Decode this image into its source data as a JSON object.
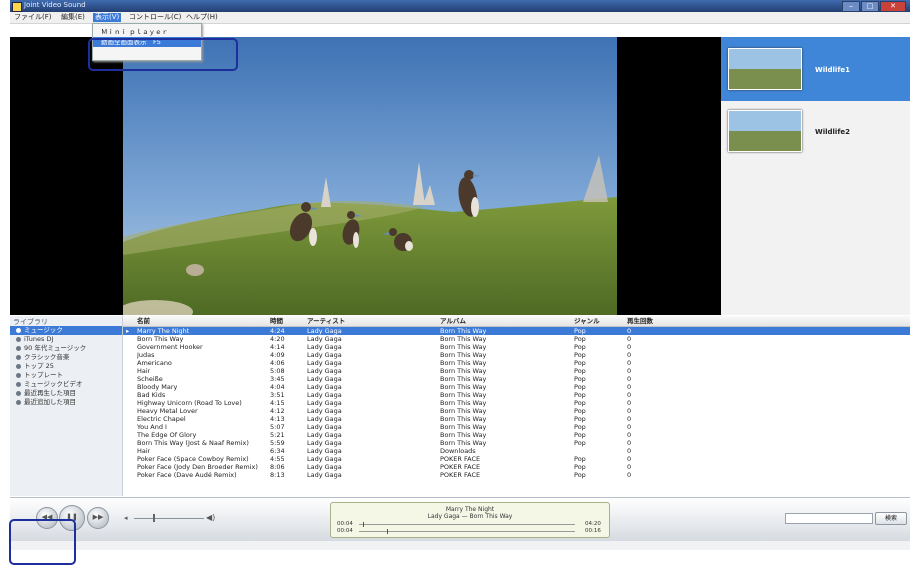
{
  "window": {
    "title": "Joint Video Sound"
  },
  "menu": [
    {
      "label": "ファイル(F)",
      "x": 0
    },
    {
      "label": "編集(E)"
    },
    {
      "label": "表示(V)"
    },
    {
      "label": "コントロール(C)"
    },
    {
      "label": "ヘルプ(H)"
    }
  ],
  "view_menu": {
    "items": [
      {
        "label": "Ｍｉｎｉ ｐｌａｙｅｒ"
      },
      {
        "label": "動画全画面表示　F5"
      }
    ]
  },
  "videos": [
    {
      "label": "Wildlife1",
      "selected": true
    },
    {
      "label": "Wildlife2",
      "selected": false
    }
  ],
  "library": {
    "header": "ライブラリ",
    "items": [
      "ミュージック",
      "iTunes DJ",
      "90 年代ミュージック",
      "クラシック音楽",
      "トップ 25",
      "トップレート",
      "ミュージックビデオ",
      "最近再生した項目",
      "最近追加した項目"
    ]
  },
  "table": {
    "columns": [
      "名前",
      "時間",
      "アーティスト",
      "アルバム",
      "ジャンル",
      "再生回数"
    ],
    "rows": [
      [
        "Marry The Night",
        "4:24",
        "Lady Gaga",
        "Born This Way",
        "Pop",
        "0"
      ],
      [
        "Born This Way",
        "4:20",
        "Lady Gaga",
        "Born This Way",
        "Pop",
        "0"
      ],
      [
        "Government Hooker",
        "4:14",
        "Lady Gaga",
        "Born This Way",
        "Pop",
        "0"
      ],
      [
        "Judas",
        "4:09",
        "Lady Gaga",
        "Born This Way",
        "Pop",
        "0"
      ],
      [
        "Americano",
        "4:06",
        "Lady Gaga",
        "Born This Way",
        "Pop",
        "0"
      ],
      [
        "Hair",
        "5:08",
        "Lady Gaga",
        "Born This Way",
        "Pop",
        "0"
      ],
      [
        "Scheiße",
        "3:45",
        "Lady Gaga",
        "Born This Way",
        "Pop",
        "0"
      ],
      [
        "Bloody Mary",
        "4:04",
        "Lady Gaga",
        "Born This Way",
        "Pop",
        "0"
      ],
      [
        "Bad Kids",
        "3:51",
        "Lady Gaga",
        "Born This Way",
        "Pop",
        "0"
      ],
      [
        "Highway Unicorn (Road To Love)",
        "4:15",
        "Lady Gaga",
        "Born This Way",
        "Pop",
        "0"
      ],
      [
        "Heavy Metal Lover",
        "4:12",
        "Lady Gaga",
        "Born This Way",
        "Pop",
        "0"
      ],
      [
        "Electric Chapel",
        "4:13",
        "Lady Gaga",
        "Born This Way",
        "Pop",
        "0"
      ],
      [
        "You And I",
        "5:07",
        "Lady Gaga",
        "Born This Way",
        "Pop",
        "0"
      ],
      [
        "The Edge Of Glory",
        "5:21",
        "Lady Gaga",
        "Born This Way",
        "Pop",
        "0"
      ],
      [
        "Born This Way (Jost & Naaf Remix)",
        "5:59",
        "Lady Gaga",
        "Born This Way",
        "Pop",
        "0"
      ],
      [
        "Hair",
        "6:34",
        "Lady Gaga",
        "Downloads",
        "",
        "0"
      ],
      [
        "Poker Face (Space Cowboy Remix)",
        "4:55",
        "Lady Gaga",
        "POKER FACE",
        "Pop",
        "0"
      ],
      [
        "Poker Face (Jody Den Broeder Remix)",
        "8:06",
        "Lady Gaga",
        "POKER FACE",
        "Pop",
        "0"
      ],
      [
        "Poker Face (Dave Audé Remix)",
        "8:13",
        "Lady Gaga",
        "POKER FACE",
        "Pop",
        "0"
      ]
    ]
  },
  "now_playing": {
    "title": "Marry The Night",
    "subtitle": "Lady Gaga — Born This Way",
    "elapsed_1": "00:04",
    "remaining_1": "04:20",
    "elapsed_2": "00:04",
    "remaining_2": "00:16"
  },
  "controls": {
    "prev_icon": "rewind-icon",
    "pause_icon": "pause-icon",
    "next_icon": "fast-forward-icon",
    "volume_low_icon": "speaker-low-icon",
    "volume_high_icon": "speaker-high-icon",
    "search_button": "検索"
  }
}
